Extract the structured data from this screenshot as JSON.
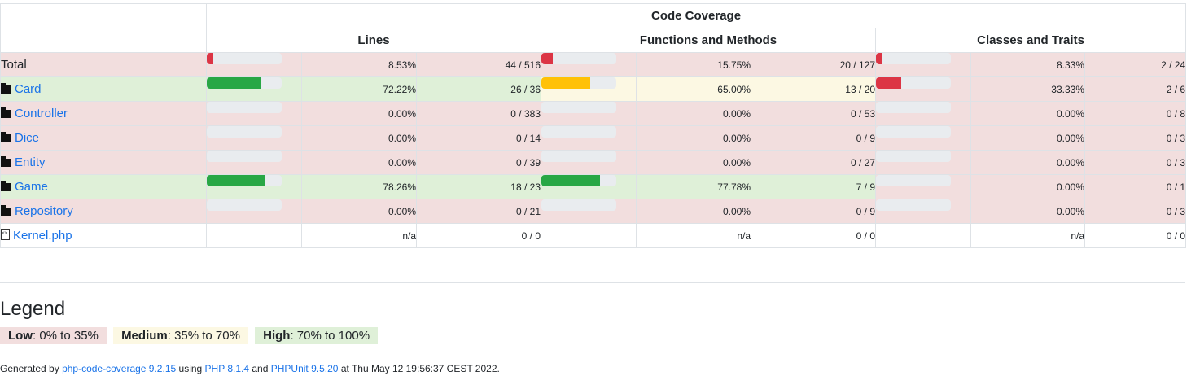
{
  "header": {
    "code_coverage": "Code Coverage",
    "lines": "Lines",
    "functions": "Functions and Methods",
    "classes": "Classes and Traits"
  },
  "colors": {
    "low": "#f2dede",
    "medium": "#fcf8e3",
    "high": "#dff0d8",
    "bar_low": "#dc3545",
    "bar_medium": "#ffc107",
    "bar_high": "#28a745",
    "link": "#1a73e8"
  },
  "rows": [
    {
      "name": "Total",
      "type": "total",
      "level": "low",
      "lines": {
        "fraction": 0.0853,
        "pct": "8.53%",
        "count": "44 / 516",
        "level": "low"
      },
      "functions": {
        "fraction": 0.1575,
        "pct": "15.75%",
        "count": "20 / 127",
        "level": "low"
      },
      "classes": {
        "fraction": 0.0833,
        "pct": "8.33%",
        "count": "2 / 24",
        "level": "low"
      }
    },
    {
      "name": "Card",
      "type": "folder",
      "level": "high",
      "lines": {
        "fraction": 0.7222,
        "pct": "72.22%",
        "count": "26 / 36",
        "level": "high"
      },
      "functions": {
        "fraction": 0.65,
        "pct": "65.00%",
        "count": "13 / 20",
        "level": "medium"
      },
      "classes": {
        "fraction": 0.3333,
        "pct": "33.33%",
        "count": "2 / 6",
        "level": "low"
      }
    },
    {
      "name": "Controller",
      "type": "folder",
      "level": "low",
      "lines": {
        "fraction": 0,
        "pct": "0.00%",
        "count": "0 / 383",
        "level": "low"
      },
      "functions": {
        "fraction": 0,
        "pct": "0.00%",
        "count": "0 / 53",
        "level": "low"
      },
      "classes": {
        "fraction": 0,
        "pct": "0.00%",
        "count": "0 / 8",
        "level": "low"
      }
    },
    {
      "name": "Dice",
      "type": "folder",
      "level": "low",
      "lines": {
        "fraction": 0,
        "pct": "0.00%",
        "count": "0 / 14",
        "level": "low"
      },
      "functions": {
        "fraction": 0,
        "pct": "0.00%",
        "count": "0 / 9",
        "level": "low"
      },
      "classes": {
        "fraction": 0,
        "pct": "0.00%",
        "count": "0 / 3",
        "level": "low"
      }
    },
    {
      "name": "Entity",
      "type": "folder",
      "level": "low",
      "lines": {
        "fraction": 0,
        "pct": "0.00%",
        "count": "0 / 39",
        "level": "low"
      },
      "functions": {
        "fraction": 0,
        "pct": "0.00%",
        "count": "0 / 27",
        "level": "low"
      },
      "classes": {
        "fraction": 0,
        "pct": "0.00%",
        "count": "0 / 3",
        "level": "low"
      }
    },
    {
      "name": "Game",
      "type": "folder",
      "level": "high",
      "lines": {
        "fraction": 0.7826,
        "pct": "78.26%",
        "count": "18 / 23",
        "level": "high"
      },
      "functions": {
        "fraction": 0.7778,
        "pct": "77.78%",
        "count": "7 / 9",
        "level": "high"
      },
      "classes": {
        "fraction": 0,
        "pct": "0.00%",
        "count": "0 / 1",
        "level": "low"
      }
    },
    {
      "name": "Repository",
      "type": "folder",
      "level": "low",
      "lines": {
        "fraction": 0,
        "pct": "0.00%",
        "count": "0 / 21",
        "level": "low"
      },
      "functions": {
        "fraction": 0,
        "pct": "0.00%",
        "count": "0 / 9",
        "level": "low"
      },
      "classes": {
        "fraction": 0,
        "pct": "0.00%",
        "count": "0 / 3",
        "level": "low"
      }
    },
    {
      "name": "Kernel.php",
      "type": "file",
      "level": "none",
      "lines": {
        "fraction": null,
        "pct": "n/a",
        "count": "0 / 0",
        "level": "none"
      },
      "functions": {
        "fraction": null,
        "pct": "n/a",
        "count": "0 / 0",
        "level": "none"
      },
      "classes": {
        "fraction": null,
        "pct": "n/a",
        "count": "0 / 0",
        "level": "none"
      }
    }
  ],
  "legend": {
    "title": "Legend",
    "low_label": "Low",
    "low_range": ": 0% to 35%",
    "medium_label": "Medium",
    "medium_range": ": 35% to 70%",
    "high_label": "High",
    "high_range": ": 70% to 100%"
  },
  "footer": {
    "generated_by": "Generated by",
    "tool_link": "php-code-coverage 9.2.15",
    "using": "using",
    "php_link": "PHP 8.1.4",
    "and": "and",
    "phpunit_link": "PHPUnit 9.5.20",
    "at": "at Thu May 12 19:56:37 CEST 2022."
  }
}
